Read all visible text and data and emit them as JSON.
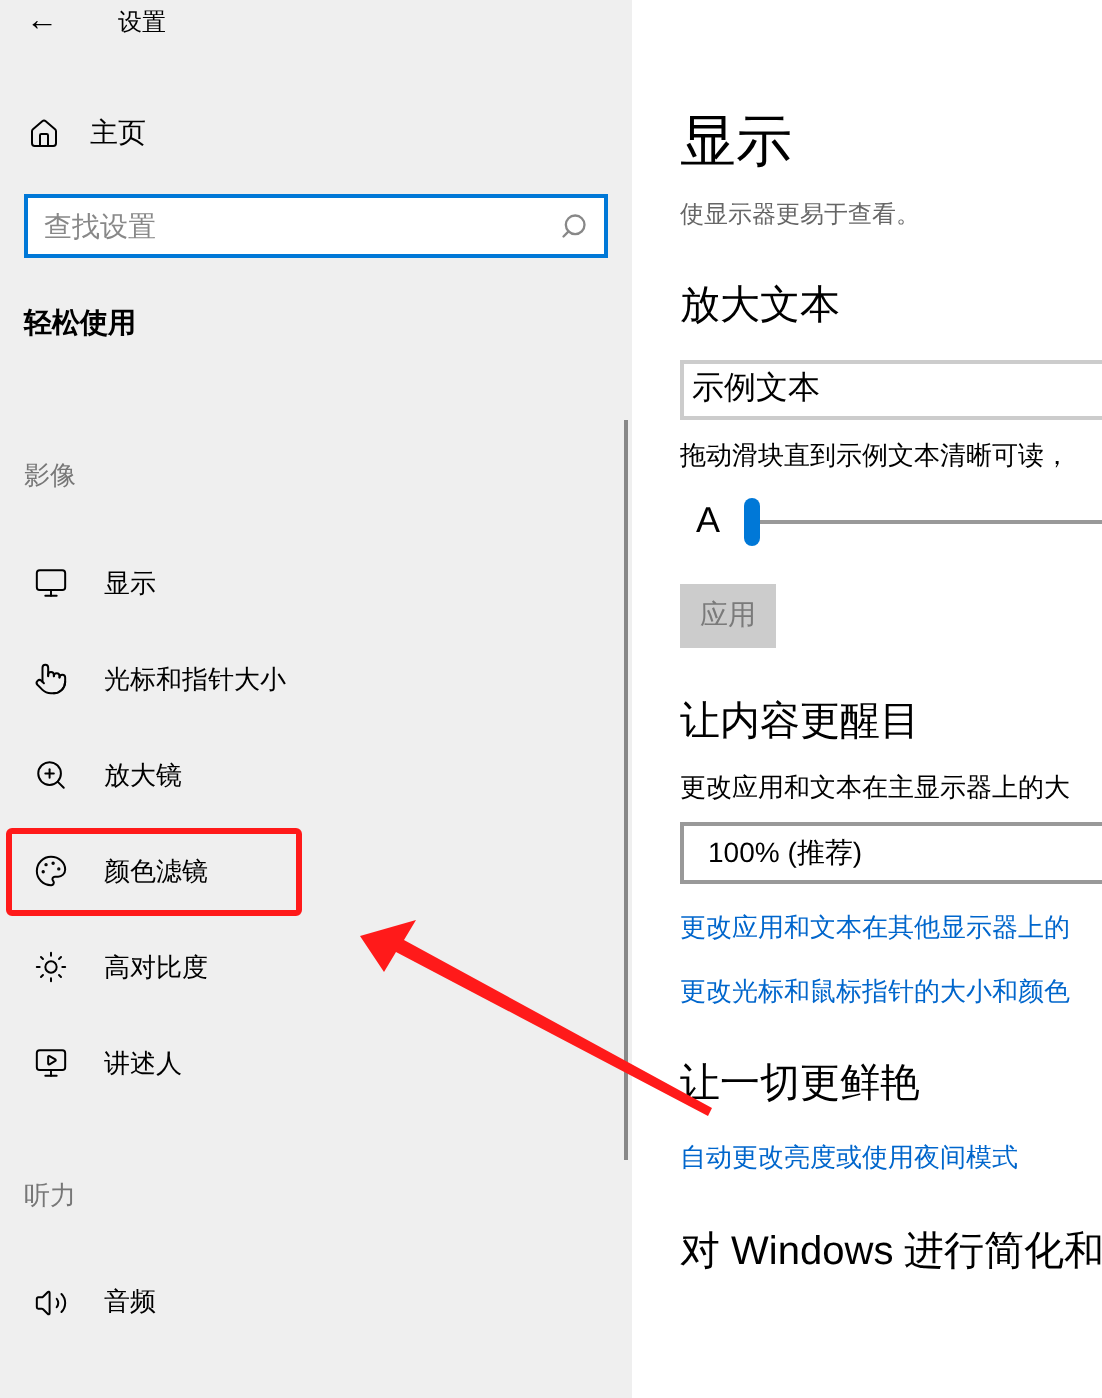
{
  "window": {
    "title": "设置",
    "back": "←"
  },
  "sidebar": {
    "home": "主页",
    "search": {
      "placeholder": "查找设置"
    },
    "heading": "轻松使用",
    "groups": [
      {
        "label": "影像",
        "items": [
          {
            "label": "显示",
            "kind": "monitor",
            "highlighted": false
          },
          {
            "label": "光标和指针大小",
            "kind": "pointer",
            "highlighted": false
          },
          {
            "label": "放大镜",
            "kind": "zoom",
            "highlighted": false
          },
          {
            "label": "颜色滤镜",
            "kind": "palette",
            "highlighted": true
          },
          {
            "label": "高对比度",
            "kind": "sun",
            "highlighted": false
          },
          {
            "label": "讲述人",
            "kind": "narrator",
            "highlighted": false
          }
        ]
      },
      {
        "label": "听力",
        "items": [
          {
            "label": "音频",
            "kind": "audio",
            "highlighted": false
          }
        ]
      }
    ]
  },
  "content": {
    "title": "显示",
    "subtitle": "使显示器更易于查看。",
    "sections": [
      {
        "heading": "放大文本",
        "blocks": [
          {
            "kind": "textbox",
            "value": "示例文本"
          },
          {
            "kind": "text",
            "text": "拖动滑块直到示例文本清晰可读，"
          },
          {
            "kind": "slider",
            "label": "A",
            "level": 0
          },
          {
            "kind": "button",
            "label": "应用",
            "disabled": true
          }
        ]
      },
      {
        "heading": "让内容更醒目",
        "blocks": [
          {
            "kind": "text",
            "text": "更改应用和文本在主显示器上的大"
          },
          {
            "kind": "dropdown",
            "value": "100% (推荐)"
          },
          {
            "kind": "link",
            "text": "更改应用和文本在其他显示器上的"
          },
          {
            "kind": "link",
            "text": "更改光标和鼠标指针的大小和颜色"
          }
        ]
      },
      {
        "heading": "让一切更鲜艳",
        "blocks": [
          {
            "kind": "link",
            "text": "自动更改亮度或使用夜间模式"
          }
        ]
      },
      {
        "heading": "对 Windows 进行简化和"
      }
    ]
  }
}
